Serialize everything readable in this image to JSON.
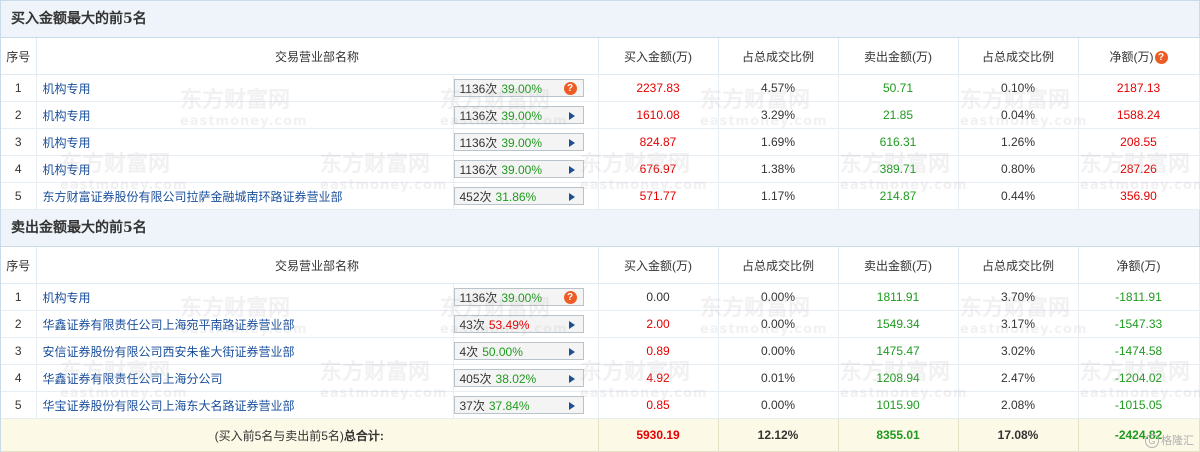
{
  "buy_section": {
    "title": "买入金额最大的前5名",
    "headers": [
      "序号",
      "交易营业部名称",
      "买入金额(万)",
      "占总成交比例",
      "卖出金额(万)",
      "占总成交比例",
      "净额(万)"
    ],
    "rows": [
      {
        "idx": "1",
        "name": "机构专用",
        "count": "1136次",
        "pct": "39.00%",
        "icon": "warning-icon",
        "buy": "2237.83",
        "buy_pct": "4.57%",
        "sell": "50.71",
        "sell_pct": "0.10%",
        "net": "2187.13"
      },
      {
        "idx": "2",
        "name": "机构专用",
        "count": "1136次",
        "pct": "39.00%",
        "icon": "arrow-icon",
        "buy": "1610.08",
        "buy_pct": "3.29%",
        "sell": "21.85",
        "sell_pct": "0.04%",
        "net": "1588.24"
      },
      {
        "idx": "3",
        "name": "机构专用",
        "count": "1136次",
        "pct": "39.00%",
        "icon": "arrow-icon",
        "buy": "824.87",
        "buy_pct": "1.69%",
        "sell": "616.31",
        "sell_pct": "1.26%",
        "net": "208.55"
      },
      {
        "idx": "4",
        "name": "机构专用",
        "count": "1136次",
        "pct": "39.00%",
        "icon": "arrow-icon",
        "buy": "676.97",
        "buy_pct": "1.38%",
        "sell": "389.71",
        "sell_pct": "0.80%",
        "net": "287.26"
      },
      {
        "idx": "5",
        "name": "东方财富证券股份有限公司拉萨金融城南环路证券营业部",
        "count": "452次",
        "pct": "31.86%",
        "icon": "arrow-icon",
        "buy": "571.77",
        "buy_pct": "1.17%",
        "sell": "214.87",
        "sell_pct": "0.44%",
        "net": "356.90"
      }
    ]
  },
  "sell_section": {
    "title": "卖出金额最大的前5名",
    "headers": [
      "序号",
      "交易营业部名称",
      "买入金额(万)",
      "占总成交比例",
      "卖出金额(万)",
      "占总成交比例",
      "净额(万)"
    ],
    "rows": [
      {
        "idx": "1",
        "name": "机构专用",
        "count": "1136次",
        "pct": "39.00%",
        "icon": "warning-icon",
        "buy": "0.00",
        "buy_pct": "0.00%",
        "sell": "1811.91",
        "sell_pct": "3.70%",
        "net": "-1811.91"
      },
      {
        "idx": "2",
        "name": "华鑫证券有限责任公司上海宛平南路证券营业部",
        "count": "43次",
        "pct": "53.49%",
        "icon": "arrow-icon",
        "buy": "2.00",
        "buy_pct": "0.00%",
        "sell": "1549.34",
        "sell_pct": "3.17%",
        "net": "-1547.33"
      },
      {
        "idx": "3",
        "name": "安信证券股份有限公司西安朱雀大街证券营业部",
        "count": "4次",
        "pct": "50.00%",
        "icon": "arrow-icon",
        "buy": "0.89",
        "buy_pct": "0.00%",
        "sell": "1475.47",
        "sell_pct": "3.02%",
        "net": "-1474.58"
      },
      {
        "idx": "4",
        "name": "华鑫证券有限责任公司上海分公司",
        "count": "405次",
        "pct": "38.02%",
        "icon": "arrow-icon",
        "buy": "4.92",
        "buy_pct": "0.01%",
        "sell": "1208.94",
        "sell_pct": "2.47%",
        "net": "-1204.02"
      },
      {
        "idx": "5",
        "name": "华宝证券股份有限公司上海东大名路证券营业部",
        "count": "37次",
        "pct": "37.84%",
        "icon": "arrow-icon",
        "buy": "0.85",
        "buy_pct": "0.00%",
        "sell": "1015.90",
        "sell_pct": "2.08%",
        "net": "-1015.05"
      }
    ]
  },
  "total": {
    "label_prefix": "(买入前5名与卖出前5名)",
    "label_strong": "总合计:",
    "buy": "5930.19",
    "buy_pct": "12.12%",
    "sell": "8355.01",
    "sell_pct": "17.08%",
    "net": "-2424.82"
  },
  "watermark": {
    "brand": "东方财富网",
    "domain": "eastmoney.com"
  },
  "corner_logo": {
    "text": "格隆汇"
  },
  "colors": {
    "buy": "#e40000",
    "sell": "#1f9a1f",
    "link": "#1a4f9c",
    "chip_green": "#1f9a1f",
    "chip_red": "#e40000"
  }
}
